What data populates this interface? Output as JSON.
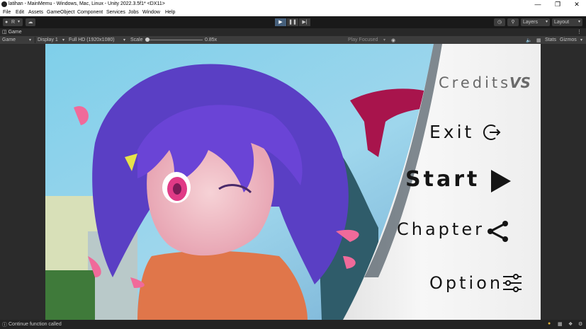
{
  "window": {
    "title": "latihan - MainMemu - Windows, Mac, Linux - Unity 2022.3.5f1* <DX11>",
    "controls": [
      "—",
      "❐",
      "✕"
    ]
  },
  "menubar": [
    "File",
    "Edit",
    "Assets",
    "GameObject",
    "Component",
    "Services",
    "Jobs",
    "Window",
    "Help"
  ],
  "toolbar": {
    "account_initial": "R",
    "layers_label": "Layers",
    "layout_label": "Layout",
    "play_icon": "play-icon",
    "pause_icon": "pause-icon",
    "step_icon": "step-icon"
  },
  "game_view": {
    "tab_label": "Game",
    "mode": "Game",
    "display": "Display 1",
    "resolution": "Full HD (1920x1080)",
    "scale_label": "Scale",
    "scale_value": "0.85x",
    "play_focused": "Play Focused",
    "stats": "Stats",
    "gizmos": "Gizmos"
  },
  "game_menu": {
    "credits": "Credits",
    "credits_logo": "VS",
    "exit": "Exit",
    "start": "Start",
    "chapter": "Chapter",
    "option": "Option"
  },
  "status": {
    "message": "Continue function called"
  },
  "colors": {
    "editor_bg": "#191919",
    "play_active": "#46607c",
    "menu_panel": "#f2f2f2",
    "menu_text": "#151515"
  }
}
